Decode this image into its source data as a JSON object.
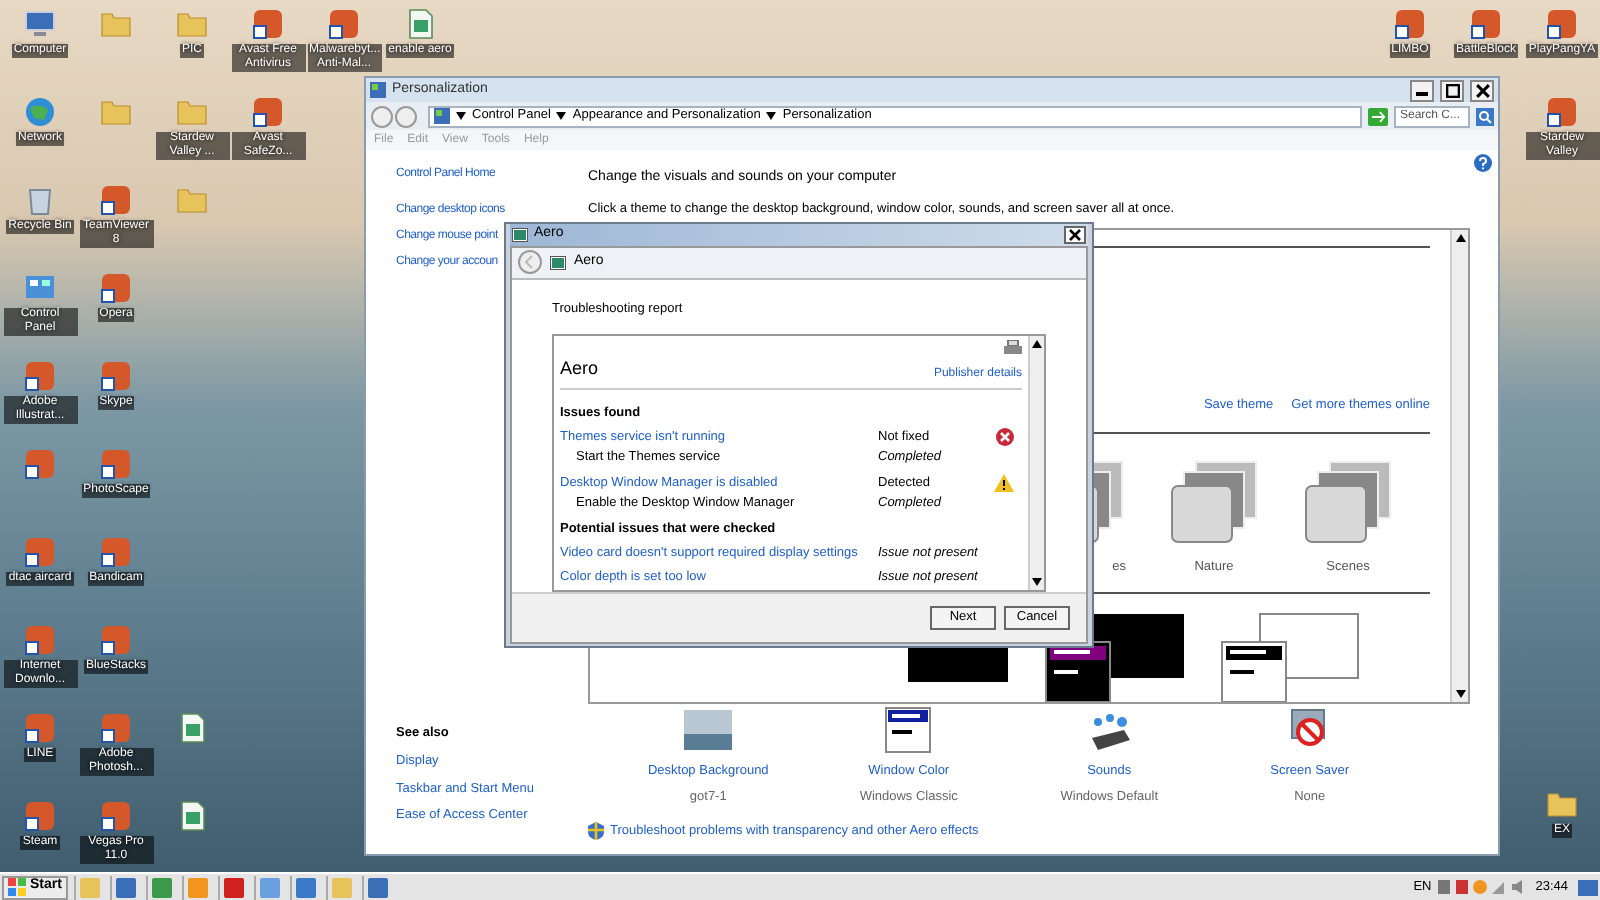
{
  "desktop": {
    "columns": [
      [
        {
          "kind": "computer",
          "label": "Computer"
        },
        {
          "kind": "globe",
          "label": "Network"
        },
        {
          "kind": "bin",
          "label": "Recycle Bin"
        },
        {
          "kind": "panel",
          "label": "Control Panel"
        },
        {
          "kind": "app",
          "label": "Adobe Illustrat..."
        },
        {
          "kind": "app"
        },
        {
          "kind": "app",
          "label": "dtac aircard"
        },
        {
          "kind": "app",
          "label": "Internet Downlo..."
        },
        {
          "kind": "app",
          "label": "LINE"
        },
        {
          "kind": "app",
          "label": "Steam"
        }
      ],
      [
        {
          "kind": "folder"
        },
        {
          "kind": "folder"
        },
        {
          "kind": "app",
          "label": "TeamViewer 8"
        },
        {
          "kind": "app",
          "label": "Opera"
        },
        {
          "kind": "app",
          "label": "Skype"
        },
        {
          "kind": "app",
          "label": "PhotoScape"
        },
        {
          "kind": "app",
          "label": "Bandicam"
        },
        {
          "kind": "app",
          "label": "BlueStacks"
        },
        {
          "kind": "app",
          "label": "Adobe Photosh..."
        },
        {
          "kind": "app",
          "label": "Vegas Pro 11.0"
        }
      ],
      [
        {
          "kind": "folder",
          "label": "PIC"
        },
        {
          "kind": "folder",
          "label": "Stardew Valley ..."
        },
        {
          "kind": "folder"
        },
        null,
        null,
        null,
        null,
        null,
        {
          "kind": "doc"
        },
        {
          "kind": "doc"
        }
      ],
      [
        {
          "kind": "app",
          "label": "Avast Free Antivirus"
        },
        {
          "kind": "app",
          "label": "Avast SafeZo..."
        }
      ],
      [
        {
          "kind": "app",
          "label": "Malwarebyt... Anti-Mal..."
        }
      ],
      [
        {
          "kind": "doc",
          "label": "enable aero"
        }
      ]
    ],
    "right_top": [
      {
        "kind": "app",
        "label": "LIMBO"
      },
      {
        "kind": "app",
        "label": "BattleBlock"
      },
      {
        "kind": "app",
        "label": "PlayPangYA"
      }
    ],
    "right_second": {
      "kind": "app",
      "label": "Stardew Valley"
    },
    "right_bottom": {
      "kind": "folder",
      "label": "EX"
    }
  },
  "window": {
    "title": "Personalization",
    "breadcrumb": [
      "Control Panel",
      "Appearance and Personalization",
      "Personalization"
    ],
    "search": {
      "placeholder": "Search C..."
    },
    "menu": [
      "File",
      "Edit",
      "View",
      "Tools",
      "Help"
    ],
    "sidebar": {
      "links": [
        "Control Panel Home",
        "Change desktop icons",
        "Change mouse point",
        "Change your accoun"
      ],
      "see_also_title": "See also",
      "see_also": [
        "Display",
        "Taskbar and Start Menu",
        "Ease of Access Center"
      ]
    },
    "heading": "Change the visuals and sounds on your computer",
    "subheading": "Click a theme to change the desktop background, window color, sounds, and screen saver all at once.",
    "theme_links": [
      "Save theme",
      "Get more themes online"
    ],
    "themes": [
      {
        "label": "es"
      },
      {
        "label": "Nature"
      },
      {
        "label": "Scenes"
      }
    ],
    "settings": [
      {
        "kind": "background",
        "label": "Desktop Background",
        "value": "got7-1"
      },
      {
        "kind": "color",
        "label": "Window Color",
        "value": "Windows Classic"
      },
      {
        "kind": "sounds",
        "label": "Sounds",
        "value": "Windows Default"
      },
      {
        "kind": "screensaver",
        "label": "Screen Saver",
        "value": "None"
      }
    ],
    "troubleshoot_link": "Troubleshoot problems with transparency and other Aero effects"
  },
  "dialog": {
    "title": "Aero",
    "nav_title": "Aero",
    "heading": "Troubleshooting report",
    "report_title": "Aero",
    "publisher_link": "Publisher details",
    "issues_title": "Issues found",
    "issues": [
      {
        "title": "Themes service isn't running",
        "status": "Not fixed",
        "kind": "error",
        "step": "Start the Themes service",
        "step_status": "Completed"
      },
      {
        "title": "Desktop Window Manager is disabled",
        "status": "Detected",
        "kind": "warning",
        "step": "Enable the Desktop Window Manager",
        "step_status": "Completed"
      }
    ],
    "checked_title": "Potential issues that were checked",
    "checked": [
      {
        "title": "Video card doesn't support required display settings",
        "status": "Issue not present"
      },
      {
        "title": "Color depth is set too low",
        "status": "Issue not present"
      }
    ],
    "buttons": [
      "Next",
      "Cancel"
    ]
  },
  "taskbar": {
    "start": "Start",
    "language": "EN",
    "clock": "23:44"
  }
}
